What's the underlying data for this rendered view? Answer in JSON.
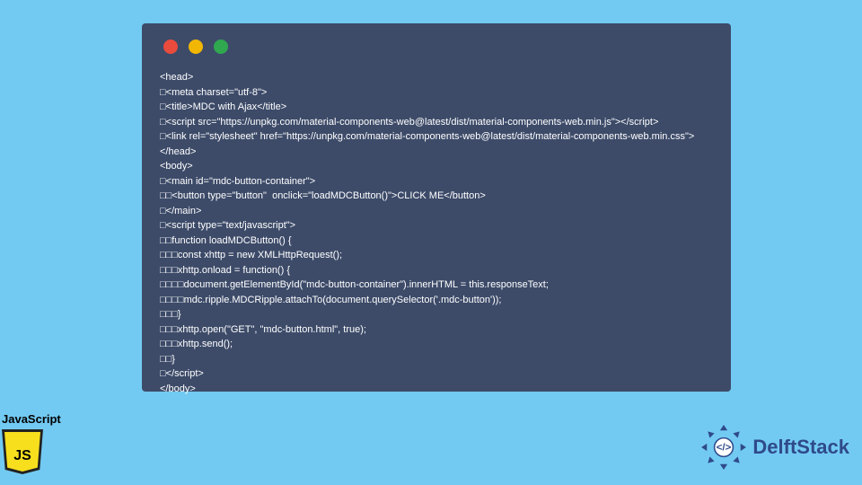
{
  "code_window": {
    "traffic": [
      "red",
      "yellow",
      "green"
    ],
    "lines": [
      "<head>",
      "□<meta charset=\"utf-8\">",
      "□<title>MDC with Ajax</title>",
      "□<script src=\"https://unpkg.com/material-components-web@latest/dist/material-components-web.min.js\"></script>",
      "□<link rel=\"stylesheet\" href=\"https://unpkg.com/material-components-web@latest/dist/material-components-web.min.css\">",
      "</head>",
      "<body>",
      "□<main id=\"mdc-button-container\">",
      "□□<button type=\"button\"  onclick=\"loadMDCButton()\">CLICK ME</button>",
      "□</main>",
      "□<script type=\"text/javascript\">",
      "□□function loadMDCButton() {",
      "□□□const xhttp = new XMLHttpRequest();",
      "□□□xhttp.onload = function() {",
      "□□□□document.getElementById(\"mdc-button-container\").innerHTML = this.responseText;",
      "□□□□mdc.ripple.MDCRipple.attachTo(document.querySelector('.mdc-button'));",
      "□□□}",
      "□□□xhttp.open(\"GET\", \"mdc-button.html\", true);",
      "□□□xhttp.send();",
      "□□}",
      "□</script>",
      "</body>"
    ]
  },
  "js_badge": {
    "label": "JavaScript",
    "shield_text": "JS"
  },
  "brand": {
    "name": "DelftStack"
  }
}
